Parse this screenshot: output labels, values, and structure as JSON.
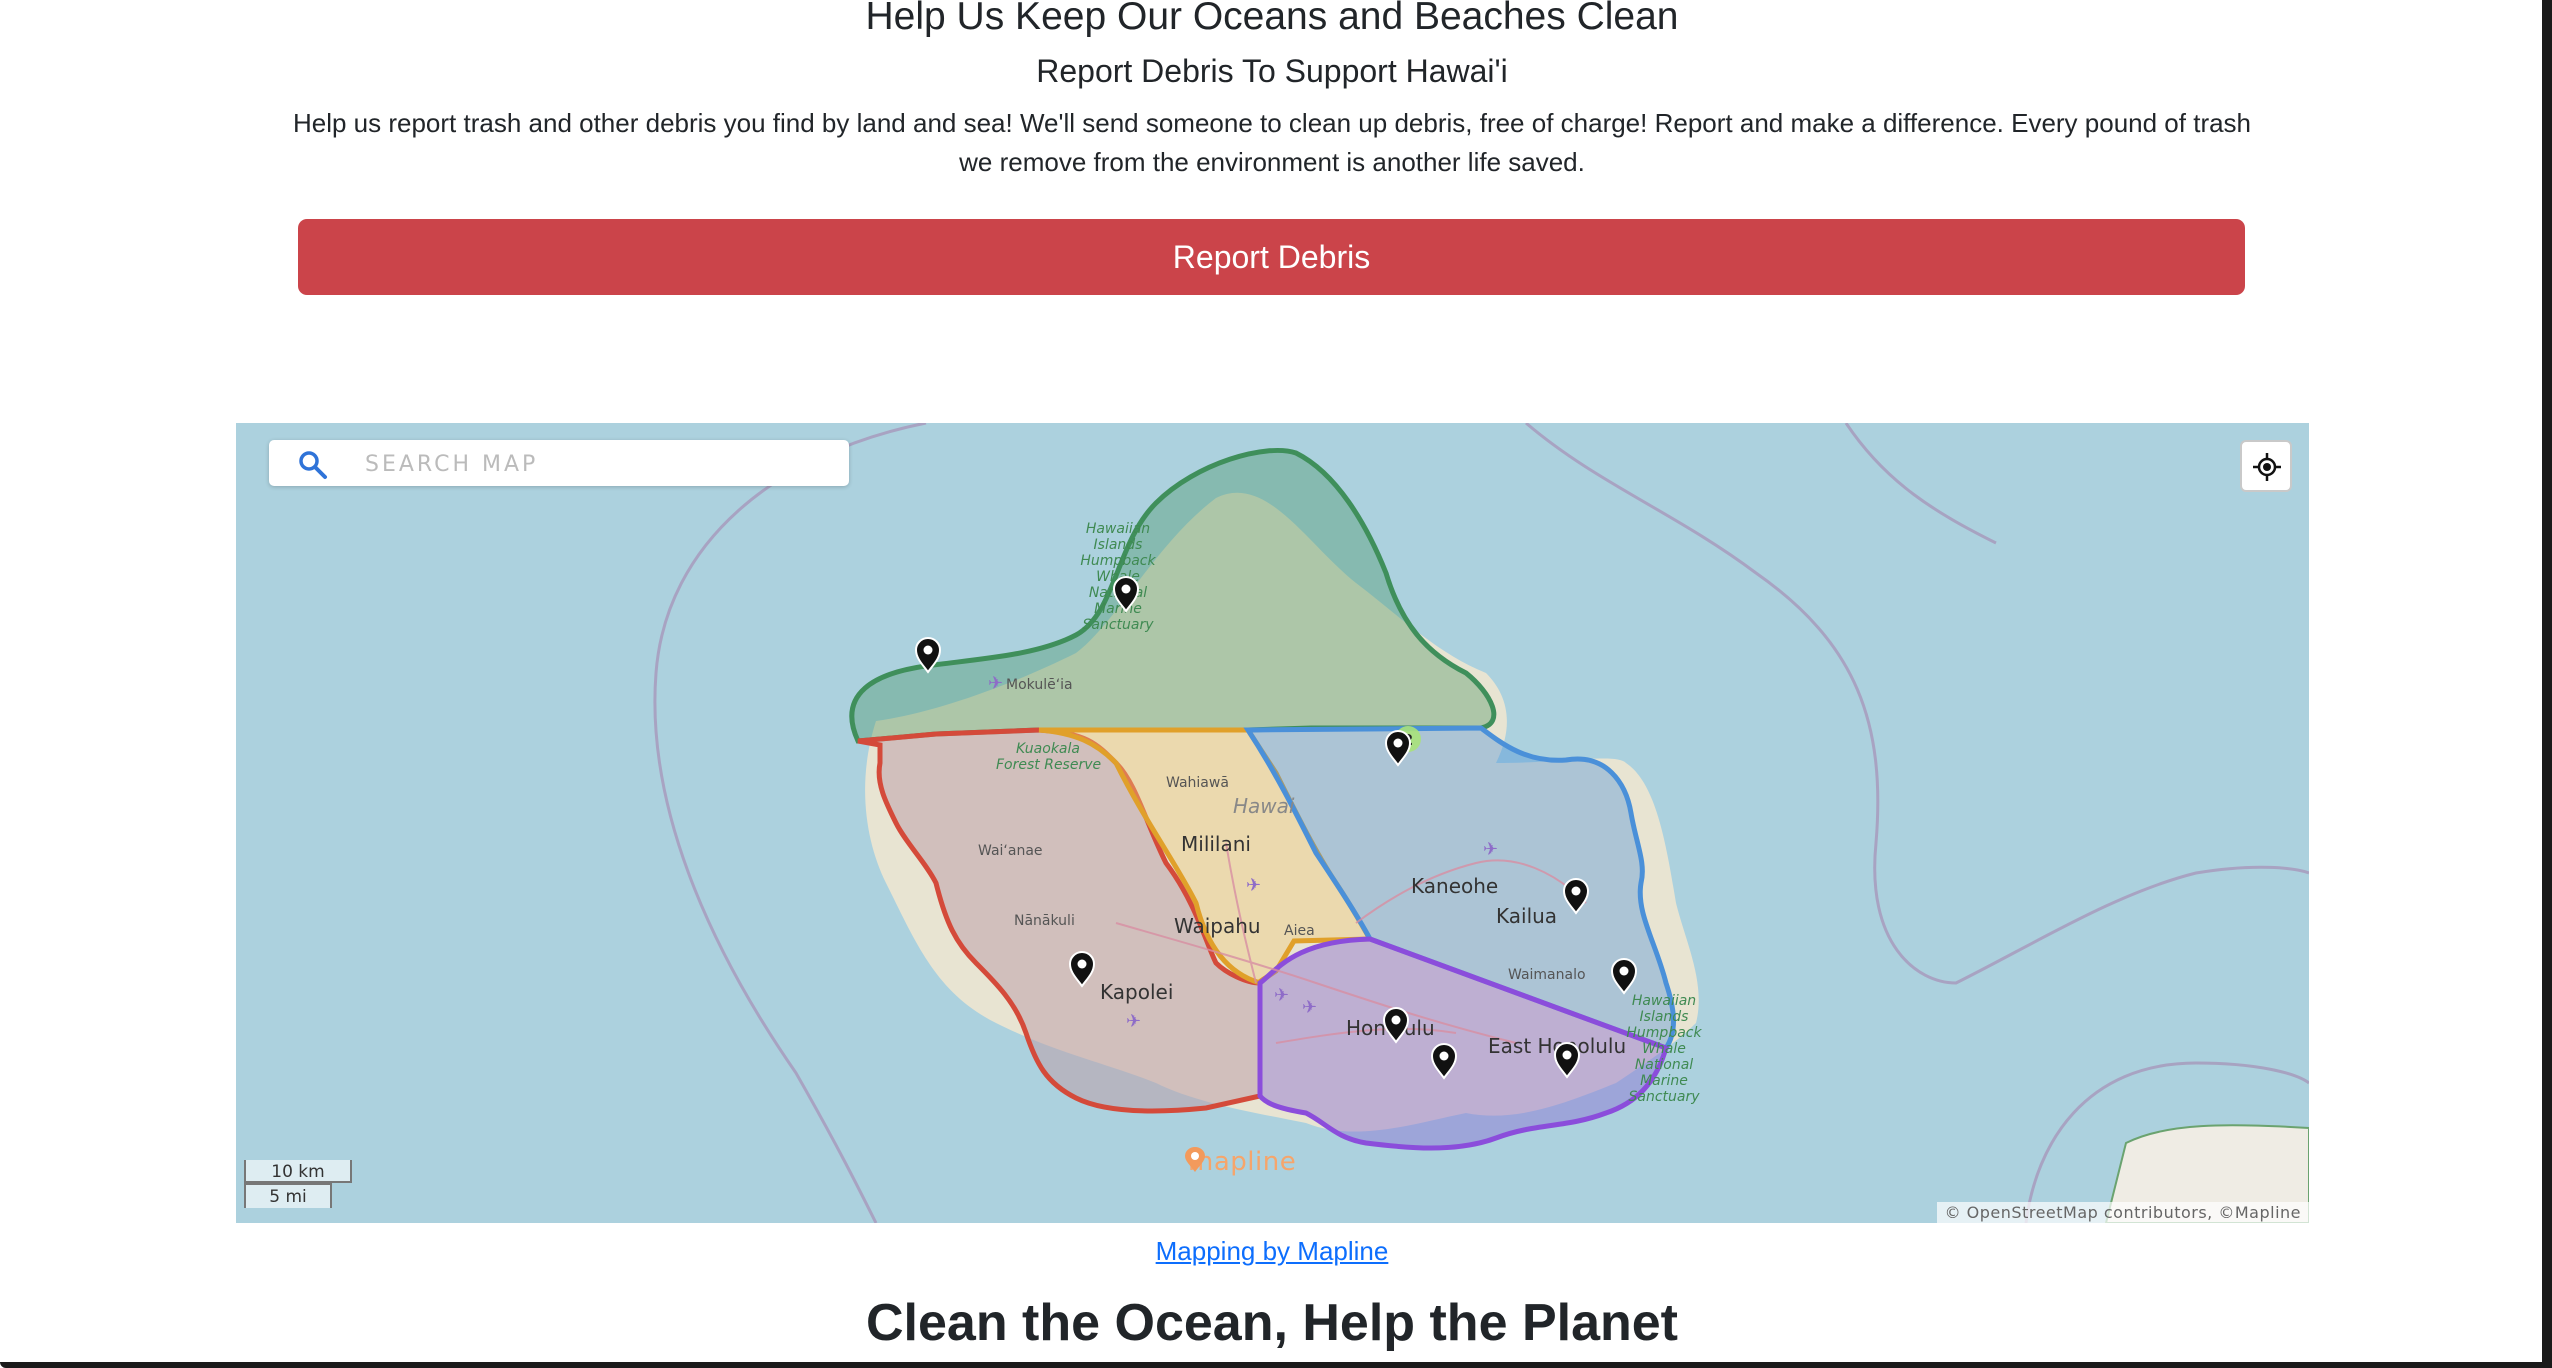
{
  "header": {
    "title": "Help Us Keep Our Oceans and Beaches Clean",
    "subtitle": "Report Debris To Support Hawai'i",
    "description": "Help us report trash and other debris you find by land and sea! We'll send someone to clean up debris, free of charge! Report and make a difference. Every pound of trash we remove from the environment is another life saved.",
    "report_button_label": "Report Debris"
  },
  "map": {
    "search": {
      "placeholder": "SEARCH MAP",
      "value": ""
    },
    "locate_icon": "crosshair-icon",
    "search_icon": "search-icon",
    "place_labels": {
      "mokuleia": "Mokulē‘ia",
      "kuaokala_1": "Kuaokala",
      "kuaokala_2": "Forest Reserve",
      "wahiawa": "Wahiawā",
      "hawaii": "Hawai",
      "mililani": "Mililani",
      "waianae": "Wai‘anae",
      "kaneohe": "Kaneohe",
      "kailua": "Kailua",
      "nanakuli": "Nānākuli",
      "waipahu": "Waipahu",
      "aiea": "Aiea",
      "kapolei": "Kapolei",
      "waimanalo": "Waimanalo",
      "honolulu": "Honolulu",
      "east_honolulu": "East Honolulu"
    },
    "sanctuary_label_north": [
      "Hawaiian",
      "Islands",
      "Humpback",
      "Whale",
      "National",
      "Marine",
      "Sanctuary"
    ],
    "sanctuary_label_east": [
      "Hawaiian",
      "Islands",
      "Humpback",
      "Whale",
      "National",
      "Marine",
      "Sanctuary"
    ],
    "cluster_count": "2",
    "scale": {
      "km_label": "10 km",
      "mi_label": "5 mi"
    },
    "watermark": "mapline",
    "attribution": "© OpenStreetMap contributors, ©Mapline",
    "region_colors": {
      "north": "#3f8f5b",
      "east": "#4a90d9",
      "central": "#e0a02a",
      "west": "#d44a3a",
      "south": "#8b4ddb"
    },
    "marker_count": 10
  },
  "credit": {
    "link_label": "Mapping by Mapline"
  },
  "section": {
    "title": "Clean the Ocean, Help the Planet"
  }
}
